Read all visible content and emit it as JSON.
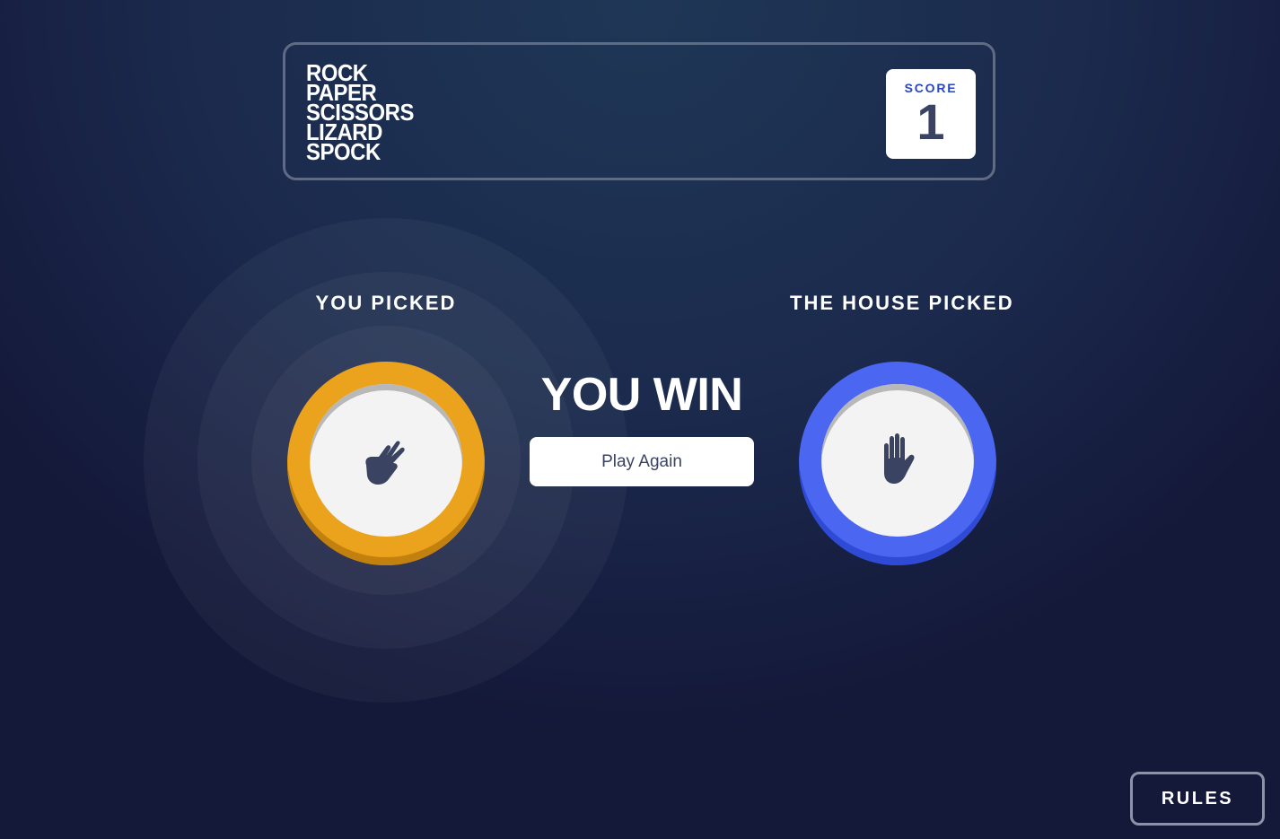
{
  "header": {
    "title_lines": [
      "ROCK",
      "PAPER",
      "SCISSORS",
      "LIZARD",
      "SPOCK"
    ],
    "score_label": "SCORE",
    "score_value": "1"
  },
  "game": {
    "you_picked_label": "YOU PICKED",
    "house_picked_label": "THE HOUSE PICKED",
    "player_choice": "spock",
    "house_choice": "paper",
    "result_text": "YOU WIN",
    "play_again_label": "Play Again"
  },
  "footer": {
    "rules_label": "RULES"
  },
  "icons": {
    "player": "spock-hand-icon",
    "house": "paper-hand-icon"
  },
  "colors": {
    "spock": "#eba21c",
    "paper": "#4b67f2",
    "score_label": "#2a45c2",
    "dark_text": "#3b4363"
  }
}
